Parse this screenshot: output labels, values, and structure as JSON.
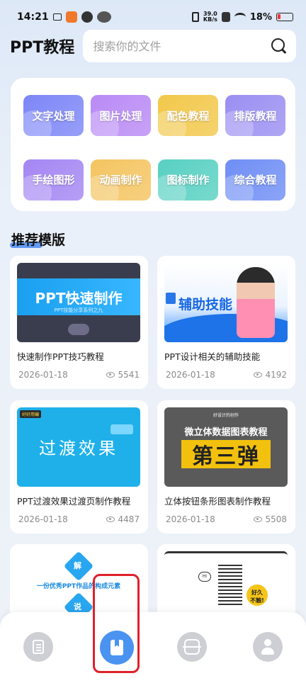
{
  "status_bar": {
    "time": "14:21",
    "net_speed": "39.0\nKB/s",
    "battery": "18%"
  },
  "header": {
    "title": "PPT教程",
    "search_placeholder": "搜索你的文件"
  },
  "categories": [
    {
      "label": "文字处理",
      "color": "#7d86f7"
    },
    {
      "label": "图片处理",
      "color": "#b98af5"
    },
    {
      "label": "配色教程",
      "color": "#f2c84b"
    },
    {
      "label": "排版教程",
      "color": "#9a8ff2"
    },
    {
      "label": "手绘图形",
      "color": "#a486f3"
    },
    {
      "label": "动画制作",
      "color": "#f4c460"
    },
    {
      "label": "图标制作",
      "color": "#57d0c2"
    },
    {
      "label": "综合教程",
      "color": "#6f8ef5"
    }
  ],
  "section_title": "推荐模版",
  "cards": [
    {
      "title": "快速制作PPT技巧教程",
      "date": "2026-01-18",
      "views": "5541",
      "thumb": {
        "main": "PPT快速制作",
        "sub": "PPT技能分享系列之九"
      }
    },
    {
      "title": "PPT设计相关的辅助技能",
      "date": "2026-01-18",
      "views": "4192",
      "thumb": {
        "main": "辅助技能"
      }
    },
    {
      "title": "PPT过渡效果过渡页制作教程",
      "date": "2026-01-18",
      "views": "4487",
      "thumb": {
        "main": "过渡效果",
        "tag": "好好用编"
      }
    },
    {
      "title": "立体按钮条形图表制作教程",
      "date": "2026-01-18",
      "views": "5508",
      "thumb": {
        "top": "好设计的创作",
        "line1": "微立体数据图表教程",
        "line2": "第三弹"
      }
    },
    {
      "title": "",
      "date": "",
      "views": "",
      "thumb": {
        "c1": "解",
        "mid": "一份优秀PPT作品的构成元素",
        "c2": "说"
      }
    },
    {
      "title": "",
      "date": "",
      "views": "",
      "thumb": {
        "hi": "Hi",
        "bubble": "好久\n不触!"
      }
    }
  ],
  "nav": {
    "items": [
      "docs-icon",
      "book-icon",
      "scan-icon",
      "user-icon"
    ],
    "active_index": 1
  }
}
